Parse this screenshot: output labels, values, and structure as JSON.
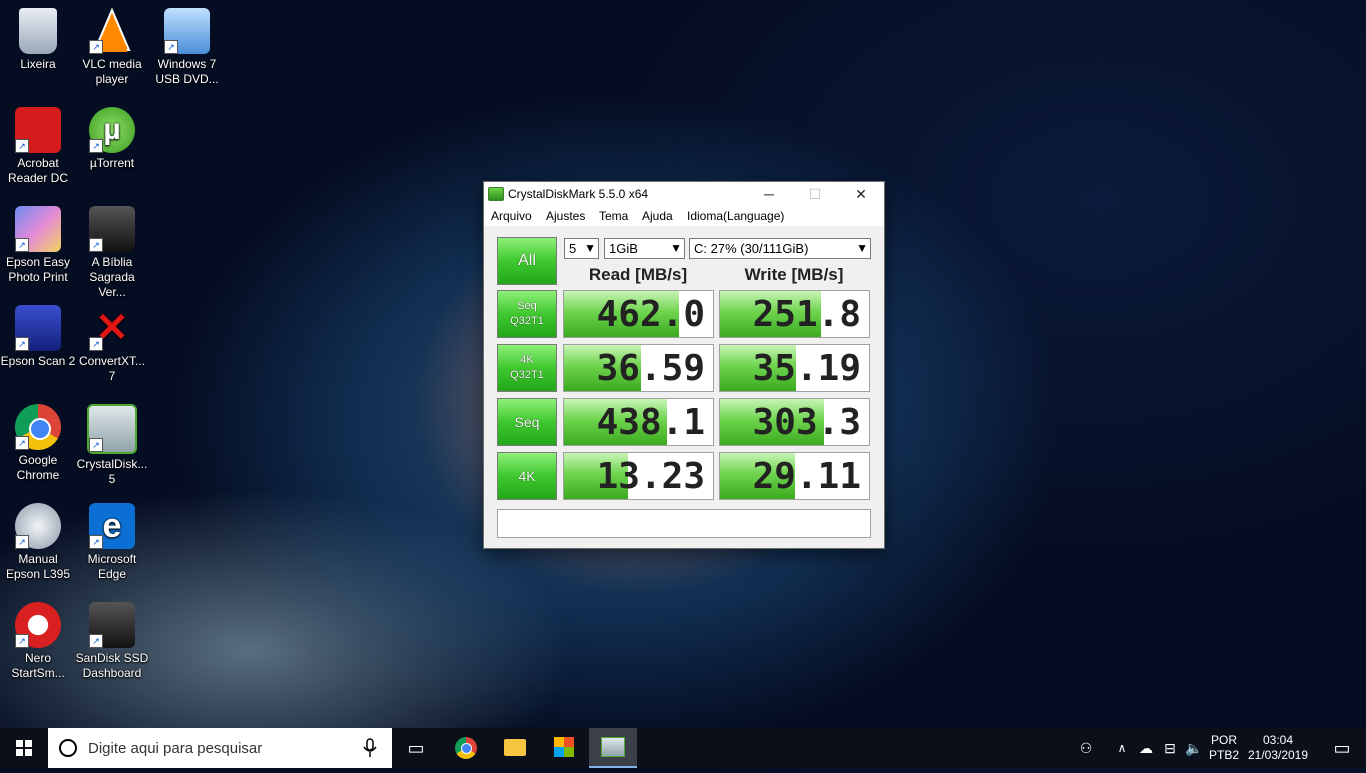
{
  "desktop_icons": [
    {
      "label": "Lixeira",
      "icon": "recycle-bin-icon"
    },
    {
      "label": "VLC media player",
      "icon": "vlc-icon"
    },
    {
      "label": "Windows 7 USB DVD...",
      "icon": "windows-usb-icon"
    },
    {
      "label": "Acrobat Reader DC",
      "icon": "acrobat-icon"
    },
    {
      "label": "µTorrent",
      "icon": "utorrent-icon"
    },
    {
      "label": "Epson Easy Photo Print",
      "icon": "epson-photo-icon"
    },
    {
      "label": "A Bíblia Sagrada Ver...",
      "icon": "bible-icon"
    },
    {
      "label": "Epson Scan 2",
      "icon": "epson-scan-icon"
    },
    {
      "label": "ConvertXT... 7",
      "icon": "convertx-icon"
    },
    {
      "label": "Google Chrome",
      "icon": "chrome-icon"
    },
    {
      "label": "CrystalDisk... 5",
      "icon": "crystaldisk-icon"
    },
    {
      "label": "Manual Epson L395",
      "icon": "manual-icon"
    },
    {
      "label": "Microsoft Edge",
      "icon": "edge-icon"
    },
    {
      "label": "Nero StartSm...",
      "icon": "nero-icon"
    },
    {
      "label": "SanDisk SSD Dashboard",
      "icon": "sandisk-icon"
    }
  ],
  "window": {
    "title": "CrystalDiskMark 5.5.0 x64",
    "minimize": "─",
    "maximize": "☐",
    "close": "✕",
    "menu": [
      "Arquivo",
      "Ajustes",
      "Tema",
      "Ajuda",
      "Idioma(Language)"
    ],
    "all_button": "All",
    "count_select": "5",
    "size_select": "1GiB",
    "drive_select": "C: 27% (30/111GiB)",
    "read_header": "Read [MB/s]",
    "write_header": "Write [MB/s]",
    "rows": [
      {
        "label1": "Seq",
        "label2": "Q32T1",
        "read": "462.0",
        "write": "251.8",
        "read_fill": 0.77,
        "write_fill": 0.68
      },
      {
        "label1": "4K",
        "label2": "Q32T1",
        "read": "36.59",
        "write": "35.19",
        "read_fill": 0.52,
        "write_fill": 0.51
      },
      {
        "label1": "Seq",
        "label2": "",
        "read": "438.1",
        "write": "303.3",
        "read_fill": 0.69,
        "write_fill": 0.7
      },
      {
        "label1": "4K",
        "label2": "",
        "read": "13.23",
        "write": "29.11",
        "read_fill": 0.43,
        "write_fill": 0.5
      }
    ],
    "status": ""
  },
  "taskbar": {
    "search_placeholder": "Digite aqui para pesquisar",
    "lang1": "POR",
    "lang2": "PTB2",
    "time": "03:04",
    "date": "21/03/2019"
  },
  "colors": {
    "accent_green": "#3fc82e",
    "taskbar": "#0a0f1a"
  }
}
